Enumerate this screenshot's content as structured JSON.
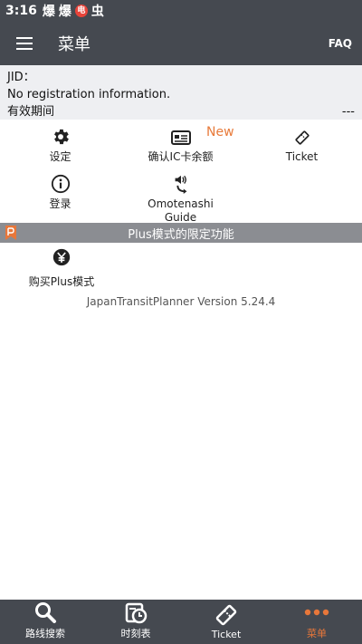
{
  "status_bar": {
    "time": "3:16",
    "icons": [
      "爆",
      "爆",
      "电",
      "虫"
    ]
  },
  "app_bar": {
    "title": "菜单",
    "faq_label": "FAQ"
  },
  "info": {
    "jid_label": "JID：",
    "registration": "No registration information.",
    "validity_label": "有效期间",
    "validity_value": "---"
  },
  "grid": {
    "settings_label": "设定",
    "ic_balance_label": "确认IC卡余额",
    "new_badge": "New",
    "ticket_label": "Ticket",
    "login_label": "登录",
    "omotenashi_label_line1": "Omotenashi",
    "omotenashi_label_line2": "Guide"
  },
  "plus_section": {
    "header": "Plus模式的限定功能",
    "buy_label": "购买Plus模式"
  },
  "version": "JapanTransitPlanner Version 5.24.4",
  "bottom_nav": {
    "route_search": "路线搜索",
    "timetable": "时刻表",
    "ticket": "Ticket",
    "menu": "菜单"
  },
  "colors": {
    "bar_bg": "#454950",
    "accent": "#e8773a",
    "section_bg": "#8b8d92",
    "info_bg": "#eeeff2"
  }
}
